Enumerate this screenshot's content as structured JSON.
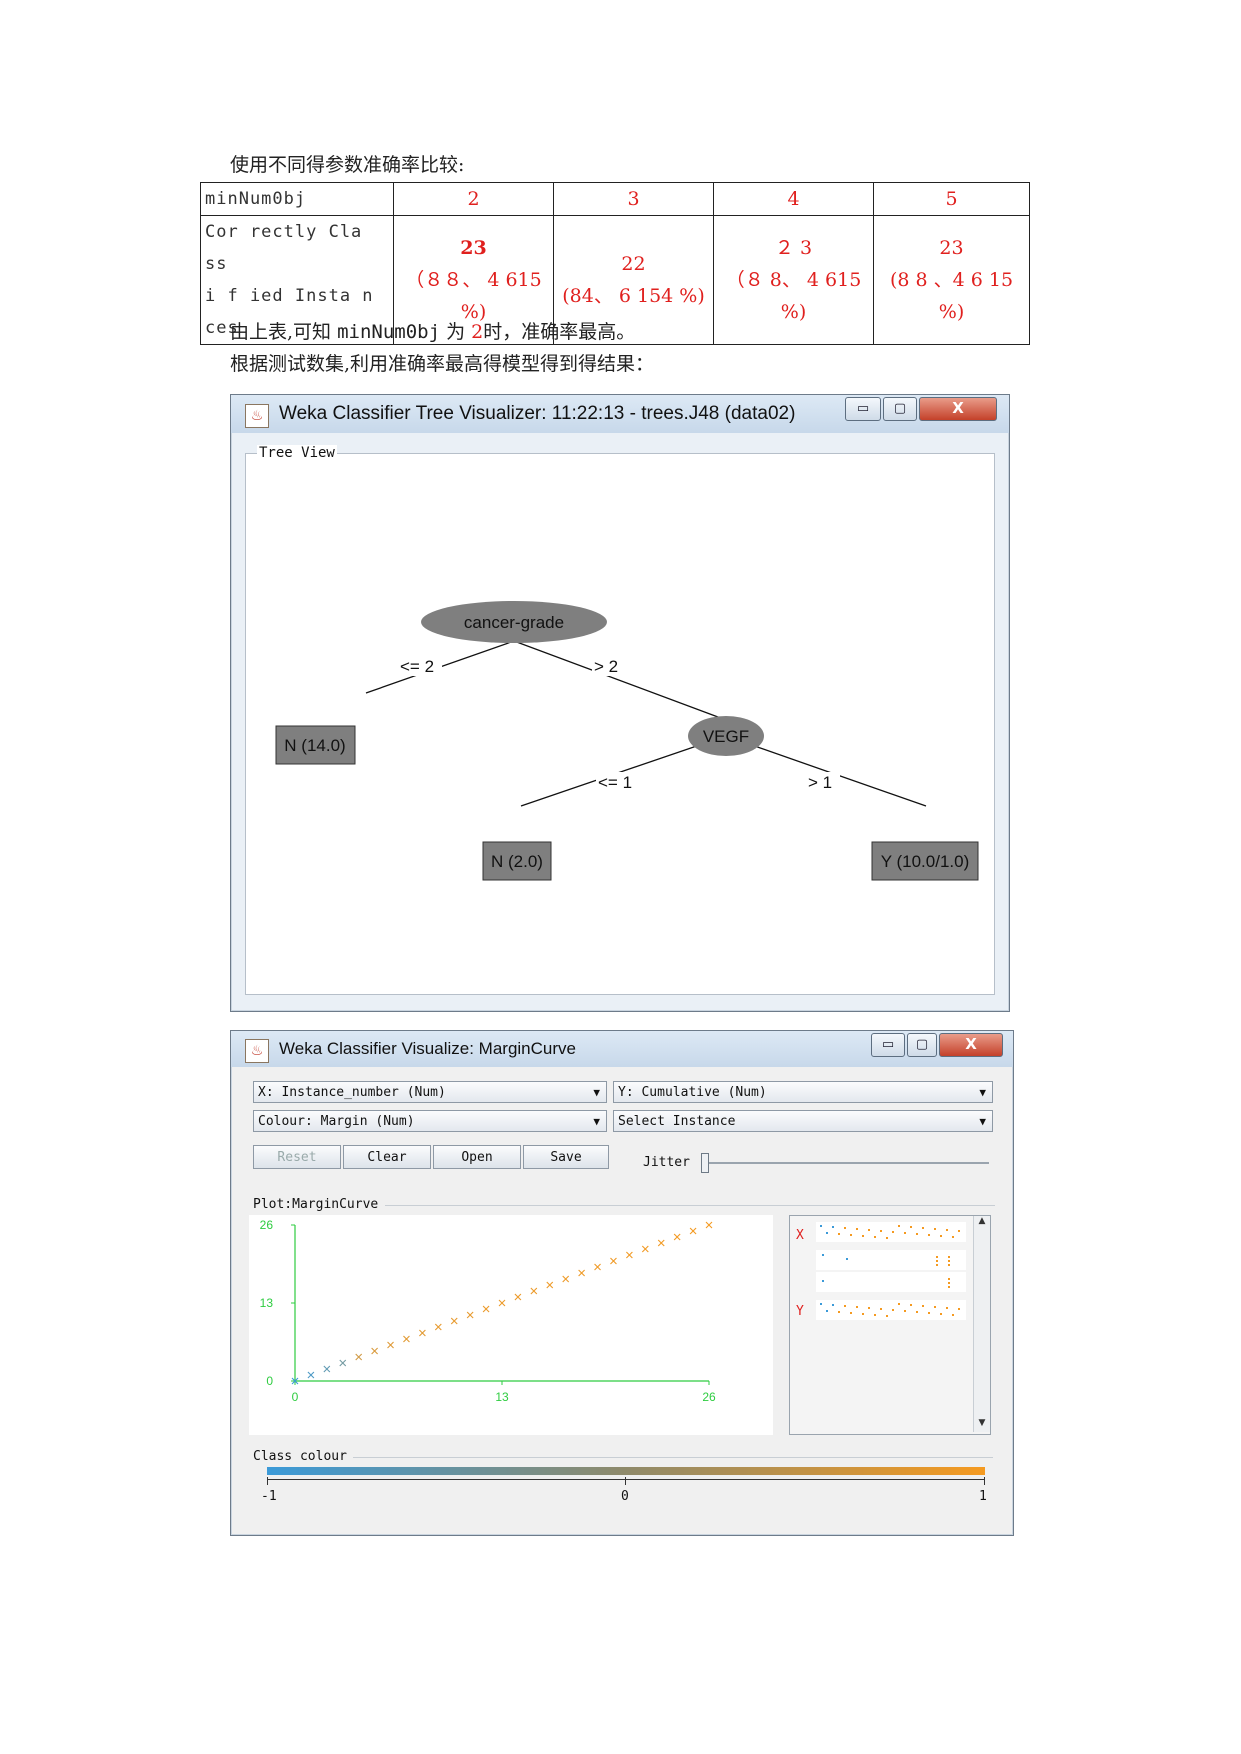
{
  "doc": {
    "intro": "使用不同得参数准确率比较:",
    "table": {
      "param_label": "minNum0bj",
      "params": [
        "2",
        "3",
        "4",
        "5"
      ],
      "metric_label_lines": [
        "Cor rectly Cla ss",
        "i f ied  Insta n",
        "ces"
      ],
      "results": [
        [
          "23",
          "（８８、 4 615",
          "%)"
        ],
        [
          "22",
          "(84、 6 154 %)"
        ],
        [
          "２ 3",
          "（８ 8、 4 615",
          "%)"
        ],
        [
          "23",
          "(8 8 、4 6 15",
          "%)"
        ]
      ]
    },
    "conclusion_pre": "由上表,可知",
    "conclusion_code": "minNum0bj",
    "conclusion_mid": "为",
    "conclusion_val": "2",
    "conclusion_post": "时，准确率最高。",
    "next_line": "根据测试数集,利用准确率最高得模型得到得结果："
  },
  "tree_window": {
    "title": "Weka Classifier Tree Visualizer: 11:22:13 - trees.J48 (data02)",
    "group_label": "Tree View",
    "nodes": {
      "root": "cancer-grade",
      "inner": "VEGF",
      "leaf1": "N (14.0)",
      "leaf2": "N (2.0)",
      "leaf3": "Y (10.0/1.0)"
    },
    "edges": {
      "root_left": "<= 2",
      "root_right": "> 2",
      "inner_left": "<= 1",
      "inner_right": "> 1"
    },
    "buttons": {
      "min": "▭",
      "max": "▢",
      "close": "X"
    }
  },
  "margin_window": {
    "title": "Weka Classifier Visualize: MarginCurve",
    "x_combo": "X: Instance_number (Num)",
    "y_combo": "Y: Cumulative (Num)",
    "colour_combo": "Colour: Margin (Num)",
    "select_combo": "Select Instance",
    "buttons": [
      "Reset",
      "Clear",
      "Open",
      "Save"
    ],
    "jitter_label": "Jitter",
    "plot_label": "Plot:MarginCurve",
    "side_labels": {
      "x": "X",
      "y": "Y"
    },
    "class_colour_label": "Class colour",
    "class_ticks": [
      "-1",
      "0",
      "1"
    ],
    "win_buttons": {
      "min": "▭",
      "max": "▢",
      "close": "X"
    },
    "colors": {
      "low": "#3b9ad8",
      "high": "#f59a20",
      "axis": "#2ecc40"
    }
  },
  "chart_data": {
    "type": "scatter",
    "title": "",
    "xlabel": "",
    "ylabel": "",
    "xlim": [
      0,
      26
    ],
    "ylim": [
      0,
      26
    ],
    "x_ticks": [
      "0",
      "13",
      "26"
    ],
    "y_ticks": [
      "0",
      "13",
      "26"
    ],
    "x": [
      0,
      1,
      2,
      3,
      4,
      5,
      6,
      7,
      8,
      9,
      10,
      11,
      12,
      13,
      14,
      15,
      16,
      17,
      18,
      19,
      20,
      21,
      22,
      23,
      24,
      25,
      26
    ],
    "y": [
      0,
      1,
      2,
      3,
      4,
      5,
      6,
      7,
      8,
      9,
      10,
      11,
      12,
      13,
      14,
      15,
      16,
      17,
      18,
      19,
      20,
      21,
      22,
      23,
      24,
      25,
      26
    ],
    "margin": [
      -1,
      -0.8,
      -0.6,
      -0.4,
      0.6,
      0.7,
      0.75,
      0.8,
      0.8,
      0.85,
      0.85,
      0.85,
      0.9,
      0.9,
      0.9,
      0.9,
      0.92,
      0.92,
      0.94,
      0.94,
      0.95,
      0.96,
      0.96,
      0.97,
      0.98,
      0.99,
      1
    ]
  }
}
